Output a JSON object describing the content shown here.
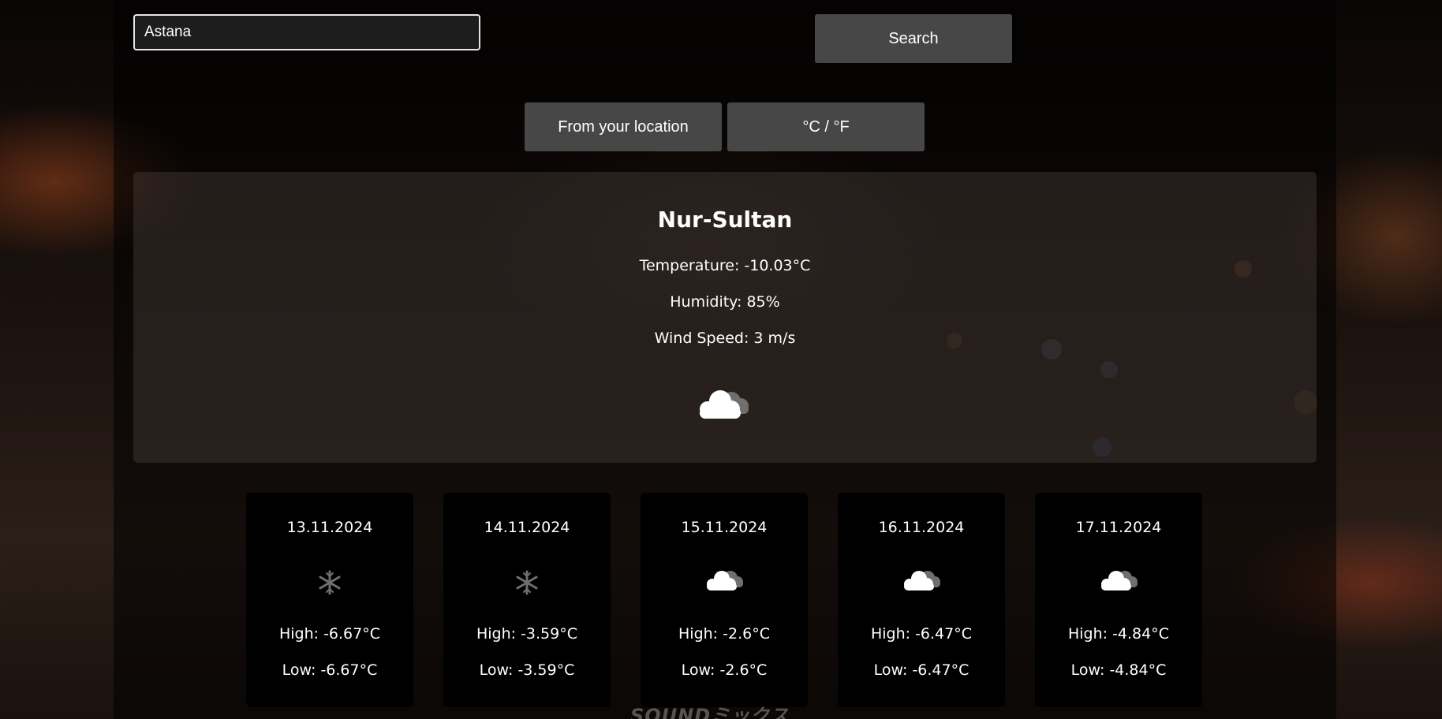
{
  "search": {
    "value": "Astana",
    "button_label": "Search"
  },
  "controls": {
    "location_label": "From your location",
    "units_label": "°C / °F"
  },
  "current": {
    "city": "Nur-Sultan",
    "temperature": "Temperature: -10.03°C",
    "humidity": "Humidity: 85%",
    "wind": "Wind Speed: 3 m/s",
    "icon": "cloudy-icon"
  },
  "forecast": [
    {
      "date": "13.11.2024",
      "icon": "snow-icon",
      "high": "High: -6.67°C",
      "low": "Low: -6.67°C"
    },
    {
      "date": "14.11.2024",
      "icon": "snow-icon",
      "high": "High: -3.59°C",
      "low": "Low: -3.59°C"
    },
    {
      "date": "15.11.2024",
      "icon": "cloudy-icon",
      "high": "High: -2.6°C",
      "low": "Low: -2.6°C"
    },
    {
      "date": "16.11.2024",
      "icon": "cloudy-icon",
      "high": "High: -6.47°C",
      "low": "Low: -6.47°C"
    },
    {
      "date": "17.11.2024",
      "icon": "cloudy-icon",
      "high": "High: -4.84°C",
      "low": "Low: -4.84°C"
    }
  ],
  "watermark": "SOUNDミックス",
  "colors": {
    "button_bg": "#474747",
    "card_bg": "#000000",
    "text": "#ffffff"
  }
}
